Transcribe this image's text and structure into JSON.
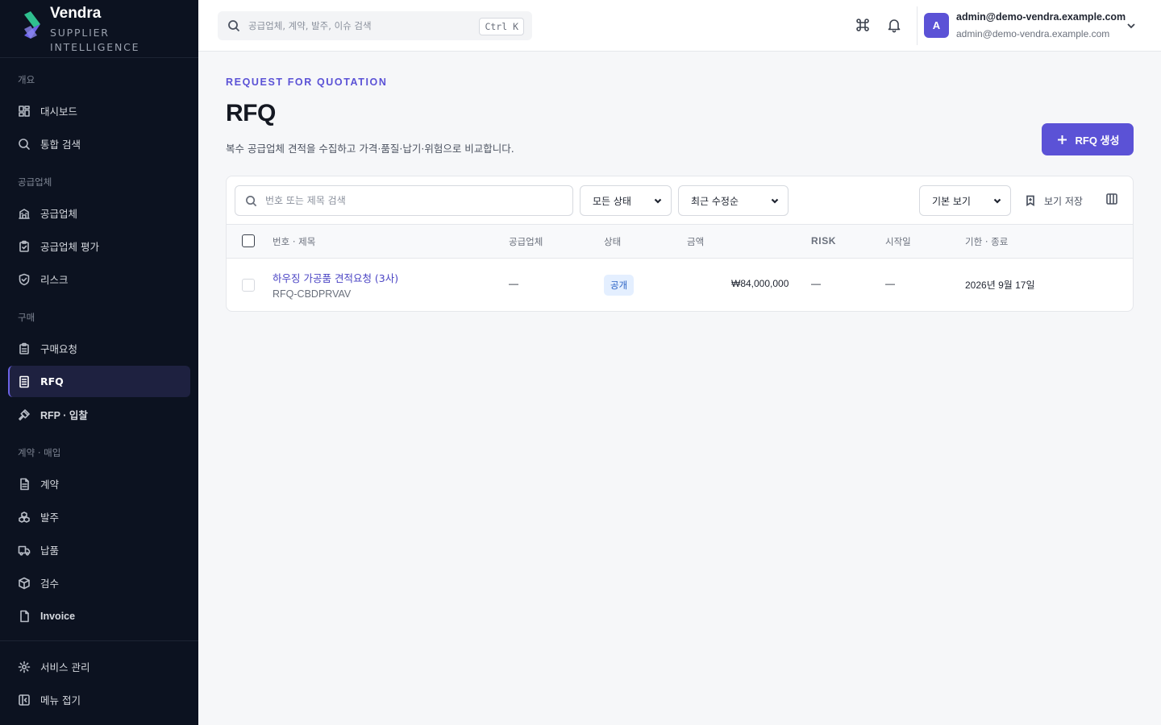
{
  "brand": {
    "name": "Vendra",
    "tagline": "SUPPLIER INTELLIGENCE"
  },
  "sidebar": {
    "sections": [
      {
        "label": "개요",
        "items": [
          {
            "label": "대시보드",
            "icon": "dashboard-icon"
          },
          {
            "label": "통합 검색",
            "icon": "search-icon"
          }
        ]
      },
      {
        "label": "공급업체",
        "items": [
          {
            "label": "공급업체",
            "icon": "building-icon"
          },
          {
            "label": "공급업체 평가",
            "icon": "clipboard-check-icon"
          },
          {
            "label": "리스크",
            "icon": "shield-icon"
          }
        ]
      },
      {
        "label": "구매",
        "items": [
          {
            "label": "구매요청",
            "icon": "clipboard-icon"
          },
          {
            "label": "RFQ",
            "icon": "document-list-icon",
            "active": true
          },
          {
            "label": "RFP · 입찰",
            "icon": "gavel-icon"
          }
        ]
      },
      {
        "label": "계약 · 매입",
        "items": [
          {
            "label": "계약",
            "icon": "contract-icon"
          },
          {
            "label": "발주",
            "icon": "boxes-icon"
          },
          {
            "label": "납품",
            "icon": "truck-icon"
          },
          {
            "label": "검수",
            "icon": "package-check-icon"
          },
          {
            "label": "Invoice",
            "icon": "invoice-icon"
          }
        ]
      }
    ],
    "footer": [
      {
        "label": "서비스 관리",
        "icon": "gear-icon"
      },
      {
        "label": "메뉴 접기",
        "icon": "sidebar-collapse-icon"
      }
    ]
  },
  "topbar": {
    "search_placeholder": "공급업체, 계약, 발주, 이슈 검색",
    "shortcut": "Ctrl K",
    "user": {
      "initial": "A",
      "name": "admin@demo-vendra.example.com",
      "email": "admin@demo-vendra.example.com"
    }
  },
  "page": {
    "eyebrow": "REQUEST FOR QUOTATION",
    "title": "RFQ",
    "description": "복수 공급업체 견적을 수집하고 가격·품질·납기·위험으로 비교합니다.",
    "create_button": "RFQ 생성"
  },
  "filters": {
    "search_placeholder": "번호 또는 제목 검색",
    "status": "모든 상태",
    "sort": "최근 수정순",
    "view": "기본 보기",
    "save_view": "보기 저장"
  },
  "table": {
    "columns": {
      "title": "번호 · 제목",
      "supplier": "공급업체",
      "status": "상태",
      "amount": "금액",
      "risk": "RISK",
      "start": "시작일",
      "due": "기한 · 종료"
    },
    "rows": [
      {
        "title": "하우징 가공품 견적요청 (3사)",
        "code": "RFQ-CBDPRVAV",
        "supplier": "—",
        "status": "공개",
        "amount": "₩84,000,000",
        "risk": "—",
        "start": "—",
        "due": "2026년 9월 17일"
      }
    ]
  },
  "colors": {
    "accent": "#5b52d6",
    "sidebar_bg": "#0c1220",
    "status_badge_bg": "#e4efff"
  }
}
